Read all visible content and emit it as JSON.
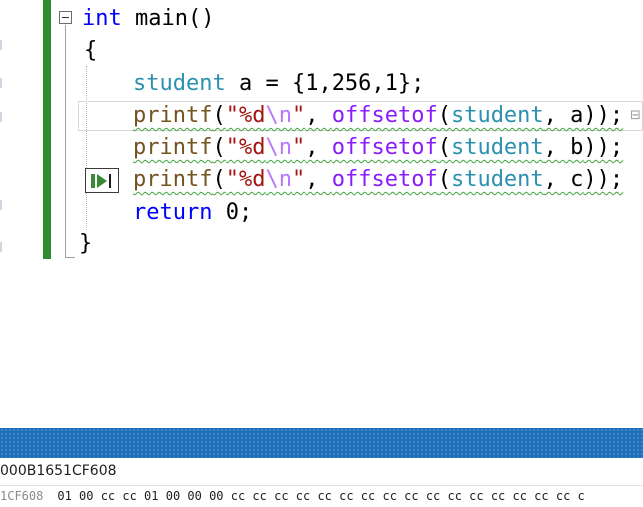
{
  "colors": {
    "change_bar": "#2e8b2e",
    "scrollbar": "#1f6fb8",
    "keyword": "#0000ff",
    "type": "#2b91af",
    "function": "#74531f",
    "string": "#a31515",
    "macro": "#8a1bff",
    "squiggle": "#3fa33f"
  },
  "code": {
    "line1": {
      "kw": "int",
      "name": " main()"
    },
    "line2": "{",
    "line3": {
      "type": "student",
      "var": " a = ",
      "init": "{1,256,1};"
    },
    "line4": {
      "fn": "printf",
      "open": "(",
      "str_a": "\"%d",
      "esc": "\\n",
      "str_b": "\"",
      "comma": ", ",
      "macro": "offsetof",
      "p1": "(",
      "type": "student",
      "arg": ", a",
      "close": "));"
    },
    "line5": {
      "fn": "printf",
      "open": "(",
      "str_a": "\"%d",
      "esc": "\\n",
      "str_b": "\"",
      "comma": ", ",
      "macro": "offsetof",
      "p1": "(",
      "type": "student",
      "arg": ", b",
      "close": "));"
    },
    "line6": {
      "fn": "printf",
      "open": "(",
      "str_a": "\"%d",
      "esc": "\\n",
      "str_b": "\"",
      "comma": ", ",
      "macro": "offsetof",
      "p1": "(",
      "type": "student",
      "arg": ", c",
      "close": "));"
    },
    "line7": {
      "kw": "return",
      "rest": " 0;"
    },
    "line8": "}"
  },
  "run_to_click_icon": "run-to-click-icon",
  "memory": {
    "address_field": "000B1651CF608",
    "row_address": "1CF608",
    "row_bytes": "01 00 cc cc 01 00 00 00 cc cc cc cc cc cc cc cc cc cc cc cc cc cc cc cc c"
  }
}
